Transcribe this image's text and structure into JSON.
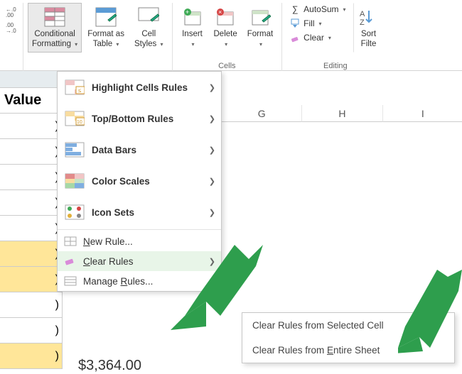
{
  "ribbon": {
    "number_group": {
      "decrease_decimal_tip": "Decrease Decimal",
      "increase_decimal_tip": "Increase Decimal"
    },
    "styles": {
      "conditional_formatting": "Conditional\nFormatting",
      "format_as_table": "Format as\nTable",
      "cell_styles": "Cell\nStyles"
    },
    "cells": {
      "insert": "Insert",
      "delete": "Delete",
      "format": "Format",
      "caption": "Cells"
    },
    "editing": {
      "autosum": "AutoSum",
      "fill": "Fill",
      "clear": "Clear",
      "sort_filter": "Sort\nFilte",
      "caption": "Editing"
    }
  },
  "menu": {
    "highlight_cells": "Highlight Cells Rules",
    "top_bottom": "Top/Bottom Rules",
    "data_bars": "Data Bars",
    "color_scales": "Color Scales",
    "icon_sets": "Icon Sets",
    "new_rule": {
      "pre": "",
      "ul": "N",
      "post": "ew Rule..."
    },
    "clear_rules": {
      "pre": "",
      "ul": "C",
      "post": "lear Rules"
    },
    "manage_rules": {
      "pre": "Manage ",
      "ul": "R",
      "post": "ules..."
    }
  },
  "submenu": {
    "selected_cells": "Clear Rules from Selected Cell",
    "entire_sheet": {
      "pre": "Clear Rules from ",
      "ul": "E",
      "post": "ntire Sheet"
    }
  },
  "sheet": {
    "header_value": "Value",
    "rows": [
      ")",
      ")",
      ")",
      ")",
      ")",
      ")",
      ")",
      ")",
      ")",
      ")"
    ],
    "overflow_value": "$3,364.00",
    "cols2": [
      "G",
      "H",
      "I"
    ]
  }
}
